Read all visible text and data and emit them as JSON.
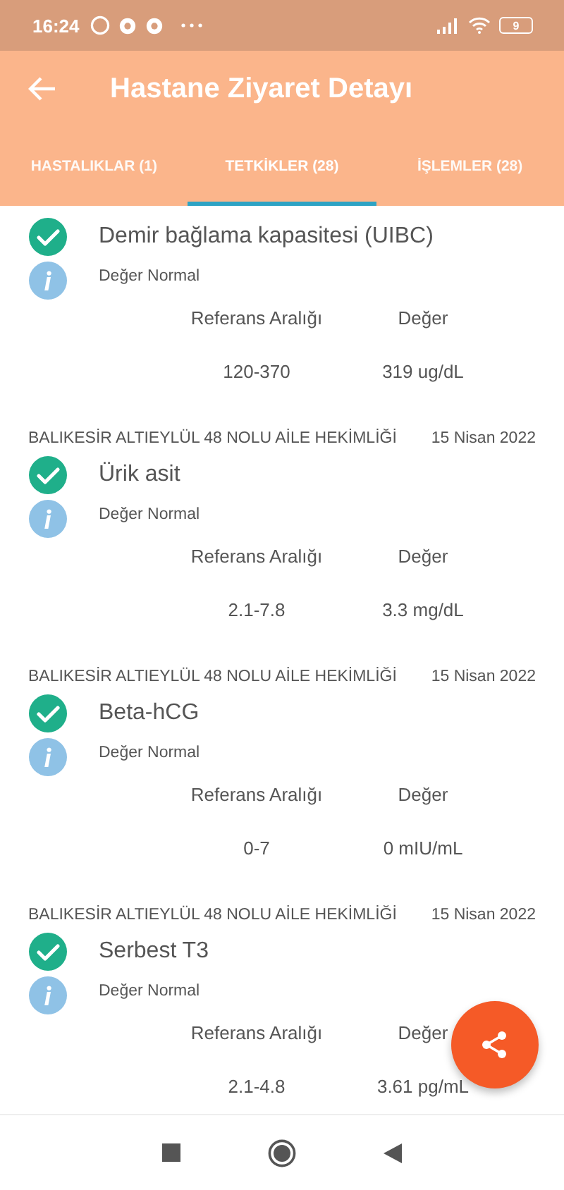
{
  "status_bar": {
    "time": "16:24",
    "battery": "9"
  },
  "app_bar": {
    "title": "Hastane Ziyaret Detayı"
  },
  "tabs": [
    {
      "label": "HASTALIKLAR (1)",
      "selected": false
    },
    {
      "label": "TETKİKLER (28)",
      "selected": true
    },
    {
      "label": "İŞLEMLER (28)",
      "selected": false
    }
  ],
  "tests": [
    {
      "name": "Demir bağlama kapasitesi (UIBC)",
      "status": "Değer Normal",
      "normal": true,
      "range_label": "Referans Aralığı",
      "value_label": "Değer",
      "range": "120-370",
      "value": "319 ug/dL"
    },
    {
      "source": "BALIKESİR ALTIEYLÜL 48 NOLU AİLE HEKİMLİĞİ",
      "date": "15 Nisan 2022",
      "name": "Ürik asit",
      "status": "Değer Normal",
      "normal": true,
      "range_label": "Referans Aralığı",
      "value_label": "Değer",
      "range": "2.1-7.8",
      "value": "3.3 mg/dL"
    },
    {
      "source": "BALIKESİR ALTIEYLÜL 48 NOLU AİLE HEKİMLİĞİ",
      "date": "15 Nisan 2022",
      "name": "Beta-hCG",
      "status": "Değer Normal",
      "normal": true,
      "range_label": "Referans Aralığı",
      "value_label": "Değer",
      "range": "0-7",
      "value": "0 mIU/mL"
    },
    {
      "source": "BALIKESİR ALTIEYLÜL 48 NOLU AİLE HEKİMLİĞİ",
      "date": "15 Nisan 2022",
      "name": "Serbest T3",
      "status": "Değer Normal",
      "normal": true,
      "range_label": "Referans Aralığı",
      "value_label": "Değer",
      "range": "2.1-4.8",
      "value": "3.61 pg/mL"
    }
  ]
}
